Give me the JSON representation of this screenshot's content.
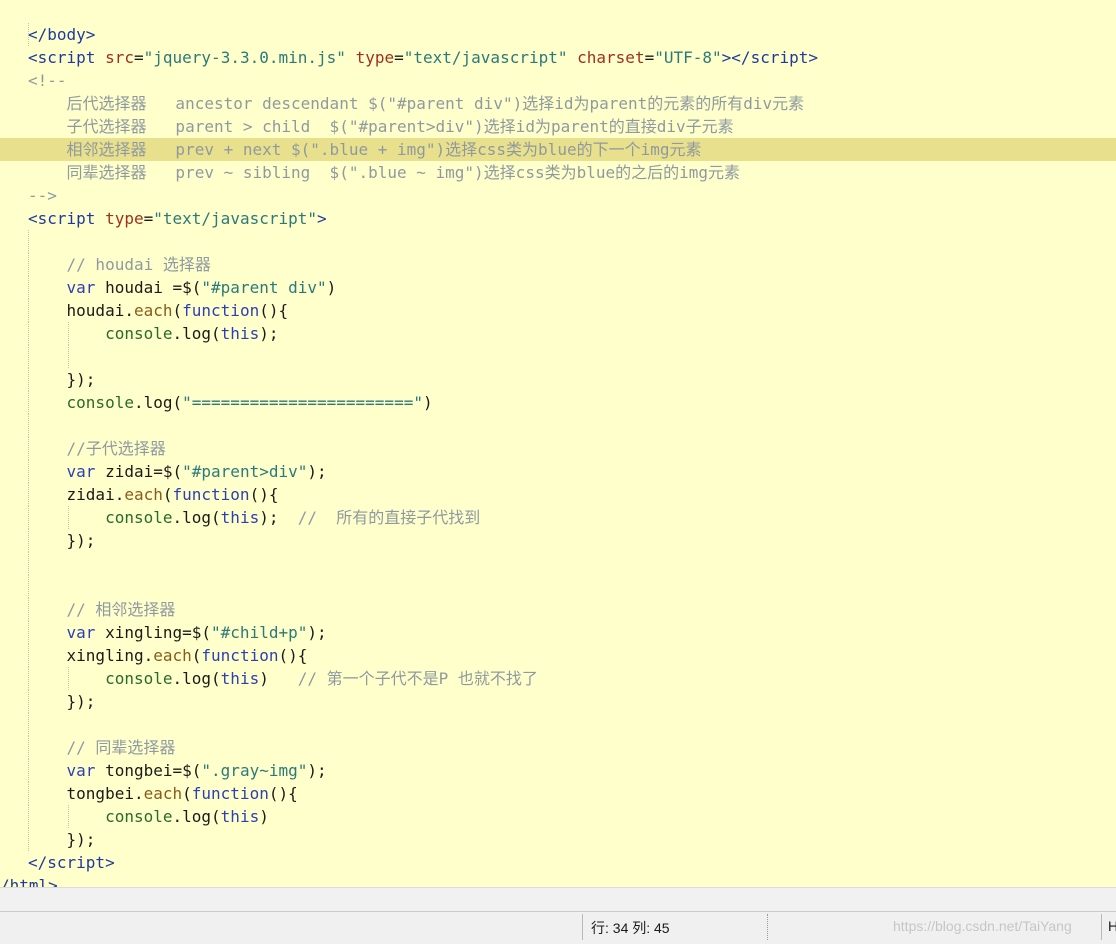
{
  "editor": {
    "line1": {
      "t1": "</",
      "t2": "body",
      "t3": ">"
    },
    "line2": {
      "t1": "<",
      "t2": "script",
      "t3": " ",
      "t4": "src",
      "t5": "=",
      "t6": "\"jquery-3.3.0.min.js\"",
      "t7": " ",
      "t8": "type",
      "t9": "=",
      "t10": "\"text/javascript\"",
      "t11": " ",
      "t12": "charset",
      "t13": "=",
      "t14": "\"UTF-8\"",
      "t15": "></",
      "t16": "script",
      "t17": ">"
    },
    "line3": {
      "t1": "<!--"
    },
    "line4": {
      "t1": "    后代选择器   ancestor descendant $(\"#parent div\")选择id为parent的元素的所有div元素"
    },
    "line5": {
      "t1": "    子代选择器   parent > child  $(\"#parent>div\")选择id为parent的直接div子元素"
    },
    "line6": {
      "t1": "    相邻选择器   prev + next $(\".blue + img\")选择css类为blue的下一个img元素"
    },
    "line7": {
      "t1": "    同辈选择器   prev ~ sibling  $(\".blue ~ img\")选择css类为blue的之后的img元素"
    },
    "line8": {
      "t1": "-->"
    },
    "line9": {
      "t1": "<",
      "t2": "script",
      "t3": " ",
      "t4": "type",
      "t5": "=",
      "t6": "\"text/javascript\"",
      "t7": ">"
    },
    "line11": {
      "t1": "    ",
      "t2": "// houdai 选择器"
    },
    "line12": {
      "t1": "    ",
      "t2": "var",
      "t3": " houdai =$(",
      "t4": "\"#parent div\"",
      "t5": ")"
    },
    "line13": {
      "t1": "    houdai.",
      "t2": "each",
      "t3": "(",
      "t4": "function",
      "t5": "(){"
    },
    "line14": {
      "t1": "        ",
      "t2": "console",
      "t3": ".log(",
      "t4": "this",
      "t5": ");"
    },
    "line16": {
      "t1": "    });"
    },
    "line17": {
      "t1": "    ",
      "t2": "console",
      "t3": ".log(",
      "t4": "\"=======================\"",
      "t5": ")"
    },
    "line19": {
      "t1": "    ",
      "t2": "//子代选择器"
    },
    "line20": {
      "t1": "    ",
      "t2": "var",
      "t3": " zidai=$(",
      "t4": "\"#parent>div\"",
      "t5": ");"
    },
    "line21": {
      "t1": "    zidai.",
      "t2": "each",
      "t3": "(",
      "t4": "function",
      "t5": "(){"
    },
    "line22": {
      "t1": "        ",
      "t2": "console",
      "t3": ".log(",
      "t4": "this",
      "t5": ");  ",
      "t6": "//  所有的直接子代找到"
    },
    "line23": {
      "t1": "    });"
    },
    "line26": {
      "t1": "    ",
      "t2": "// 相邻选择器"
    },
    "line27": {
      "t1": "    ",
      "t2": "var",
      "t3": " xingling=$(",
      "t4": "\"#child+p\"",
      "t5": ");"
    },
    "line28": {
      "t1": "    xingling.",
      "t2": "each",
      "t3": "(",
      "t4": "function",
      "t5": "(){"
    },
    "line29": {
      "t1": "        ",
      "t2": "console",
      "t3": ".log(",
      "t4": "this",
      "t5": ")   ",
      "t6": "// 第一个子代不是P 也就不找了"
    },
    "line30": {
      "t1": "    });"
    },
    "line32": {
      "t1": "    ",
      "t2": "// 同辈选择器"
    },
    "line33": {
      "t1": "    ",
      "t2": "var",
      "t3": " tongbei=$(",
      "t4": "\".gray~img\"",
      "t5": ");"
    },
    "line34": {
      "t1": "    tongbei.",
      "t2": "each",
      "t3": "(",
      "t4": "function",
      "t5": "(){"
    },
    "line35": {
      "t1": "        ",
      "t2": "console",
      "t3": ".log(",
      "t4": "this",
      "t5": ")"
    },
    "line36": {
      "t1": "    });"
    },
    "line37": {
      "t1": "</",
      "t2": "script",
      "t3": ">"
    },
    "line38": {
      "t1": "/html>"
    }
  },
  "statusbar": {
    "position": "行: 34 列: 45",
    "watermark": "https://blog.csdn.net/TaiYang",
    "right": "H"
  },
  "colors": {
    "editor_bg": "#ffffcc",
    "current_line": "#e8e08c",
    "tag": "#1f3a9e",
    "attr": "#a0301c",
    "string": "#2a7a7a",
    "comment": "#8f9aa0"
  }
}
